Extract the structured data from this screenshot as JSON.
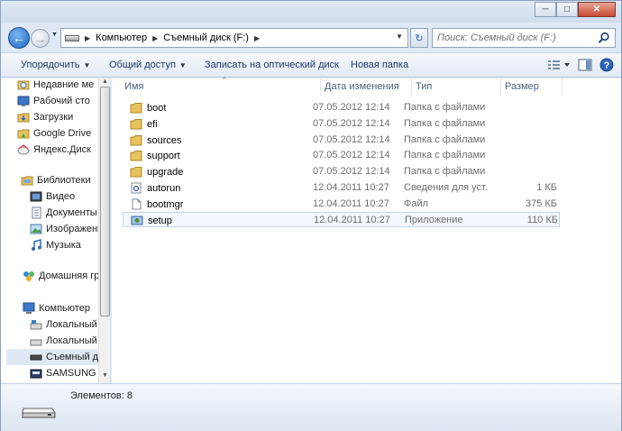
{
  "address": {
    "crumbs": [
      "Компьютер",
      "Съемный диск (F:)"
    ]
  },
  "search": {
    "placeholder": "Поиск: Съемный диск (F:)"
  },
  "toolbar": {
    "organize": "Упорядочить",
    "share": "Общий доступ",
    "burn": "Записать на оптический диск",
    "new_folder": "Новая папка"
  },
  "nav": {
    "items": [
      {
        "label": "Недавние ме",
        "icon": "recent-places-icon"
      },
      {
        "label": "Рабочий сто",
        "icon": "desktop-icon"
      },
      {
        "label": "Загрузки",
        "icon": "downloads-folder-icon"
      },
      {
        "label": "Google Drive",
        "icon": "google-drive-folder-icon"
      },
      {
        "label": "Яндекс.Диск",
        "icon": "yandex-disk-icon"
      },
      {
        "label": "Библиотеки",
        "icon": "libraries-icon"
      },
      {
        "label": "Видео",
        "icon": "video-library-icon"
      },
      {
        "label": "Документы",
        "icon": "documents-library-icon"
      },
      {
        "label": "Изображени",
        "icon": "pictures-library-icon"
      },
      {
        "label": "Музыка",
        "icon": "music-library-icon"
      },
      {
        "label": "Домашняя гру",
        "icon": "homegroup-icon"
      },
      {
        "label": "Компьютер",
        "icon": "computer-icon"
      },
      {
        "label": "Локальный",
        "icon": "local-disk-icon"
      },
      {
        "label": "Локальный",
        "icon": "local-disk-icon"
      },
      {
        "label": "Съемный ди",
        "icon": "removable-disk-icon"
      },
      {
        "label": "SAMSUNG (K",
        "icon": "samsung-drive-icon"
      }
    ]
  },
  "columns": {
    "name": "Имя",
    "date": "Дата изменения",
    "type": "Тип",
    "size": "Размер"
  },
  "files": [
    {
      "name": "boot",
      "date": "07.05.2012 12:14",
      "type": "Папка с файлами",
      "size": "",
      "icon": "folder-icon"
    },
    {
      "name": "efi",
      "date": "07.05.2012 12:14",
      "type": "Папка с файлами",
      "size": "",
      "icon": "folder-icon"
    },
    {
      "name": "sources",
      "date": "07.05.2012 12:14",
      "type": "Папка с файлами",
      "size": "",
      "icon": "folder-icon"
    },
    {
      "name": "support",
      "date": "07.05.2012 12:14",
      "type": "Папка с файлами",
      "size": "",
      "icon": "folder-icon"
    },
    {
      "name": "upgrade",
      "date": "07.05.2012 12:14",
      "type": "Папка с файлами",
      "size": "",
      "icon": "folder-icon"
    },
    {
      "name": "autorun",
      "date": "12.04.2011 10:27",
      "type": "Сведения для уст...",
      "size": "1 КБ",
      "icon": "settings-file-icon"
    },
    {
      "name": "bootmgr",
      "date": "12.04.2011 10:27",
      "type": "Файл",
      "size": "375 КБ",
      "icon": "file-icon"
    },
    {
      "name": "setup",
      "date": "12.04.2011 10:27",
      "type": "Приложение",
      "size": "110 КБ",
      "icon": "setup-app-icon"
    }
  ],
  "status": {
    "count": "Элементов: 8"
  },
  "colors": {
    "folder": "#e8c25a",
    "accent": "#2365b8",
    "selection": "#dfe8f3"
  }
}
